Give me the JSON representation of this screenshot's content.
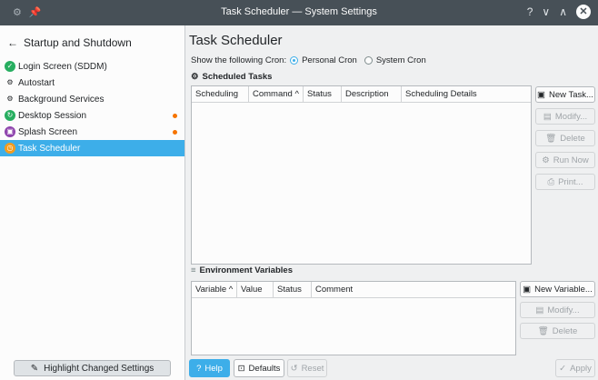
{
  "window": {
    "title": "Task Scheduler — System Settings",
    "pin_icon": "pin-icon",
    "help_glyph": "?",
    "minimize_glyph": "∨",
    "maximize_glyph": "∧",
    "close_glyph": "✕"
  },
  "sidebar": {
    "back_glyph": "←",
    "header": "Startup and Shutdown",
    "items": [
      {
        "label": "Login Screen (SDDM)",
        "icon": "login-icon",
        "icon_color": "#27ae60",
        "glyph": "✓",
        "changed": false
      },
      {
        "label": "Autostart",
        "icon": "autostart-icon",
        "icon_color": "#fcfcfc",
        "glyph": "⚙",
        "changed": false
      },
      {
        "label": "Background Services",
        "icon": "services-icon",
        "icon_color": "#fcfcfc",
        "glyph": "⚙",
        "changed": false
      },
      {
        "label": "Desktop Session",
        "icon": "session-icon",
        "icon_color": "#27ae60",
        "glyph": "↻",
        "changed": true
      },
      {
        "label": "Splash Screen",
        "icon": "splash-icon",
        "icon_color": "#8e44ad",
        "glyph": "▣",
        "changed": true
      },
      {
        "label": "Task Scheduler",
        "icon": "clock-icon",
        "icon_color": "#f39c1f",
        "glyph": "◷",
        "changed": false,
        "active": true
      }
    ],
    "highlight_button": "Highlight Changed Settings",
    "highlight_glyph": "✎"
  },
  "main": {
    "title": "Task Scheduler",
    "cron_label": "Show the following Cron:",
    "cron_options": [
      "Personal Cron",
      "System Cron"
    ],
    "cron_selected": "Personal Cron",
    "tasks": {
      "title": "Scheduled Tasks",
      "columns": [
        "Scheduling",
        "Command ^",
        "Status",
        "Description",
        "Scheduling Details"
      ],
      "buttons": [
        {
          "label": "New Task...",
          "glyph": "▣",
          "enabled": true
        },
        {
          "label": "Modify...",
          "glyph": "▤",
          "enabled": false
        },
        {
          "label": "Delete",
          "glyph": "🗑",
          "enabled": false
        },
        {
          "label": "Run Now",
          "glyph": "⚙",
          "enabled": false
        },
        {
          "label": "Print...",
          "glyph": "⎙",
          "enabled": false
        }
      ]
    },
    "env": {
      "title": "Environment Variables",
      "collapse_glyph": "≡",
      "columns": [
        "Variable ^",
        "Value",
        "Status",
        "Comment"
      ],
      "buttons": [
        {
          "label": "New Variable...",
          "glyph": "▣",
          "enabled": true
        },
        {
          "label": "Modify...",
          "glyph": "▤",
          "enabled": false
        },
        {
          "label": "Delete",
          "glyph": "🗑",
          "enabled": false
        }
      ]
    }
  },
  "footer": {
    "help": "Help",
    "help_glyph": "?",
    "defaults": "Defaults",
    "defaults_glyph": "⊡",
    "reset": "Reset",
    "reset_glyph": "↺",
    "apply": "Apply",
    "apply_glyph": "✓"
  }
}
